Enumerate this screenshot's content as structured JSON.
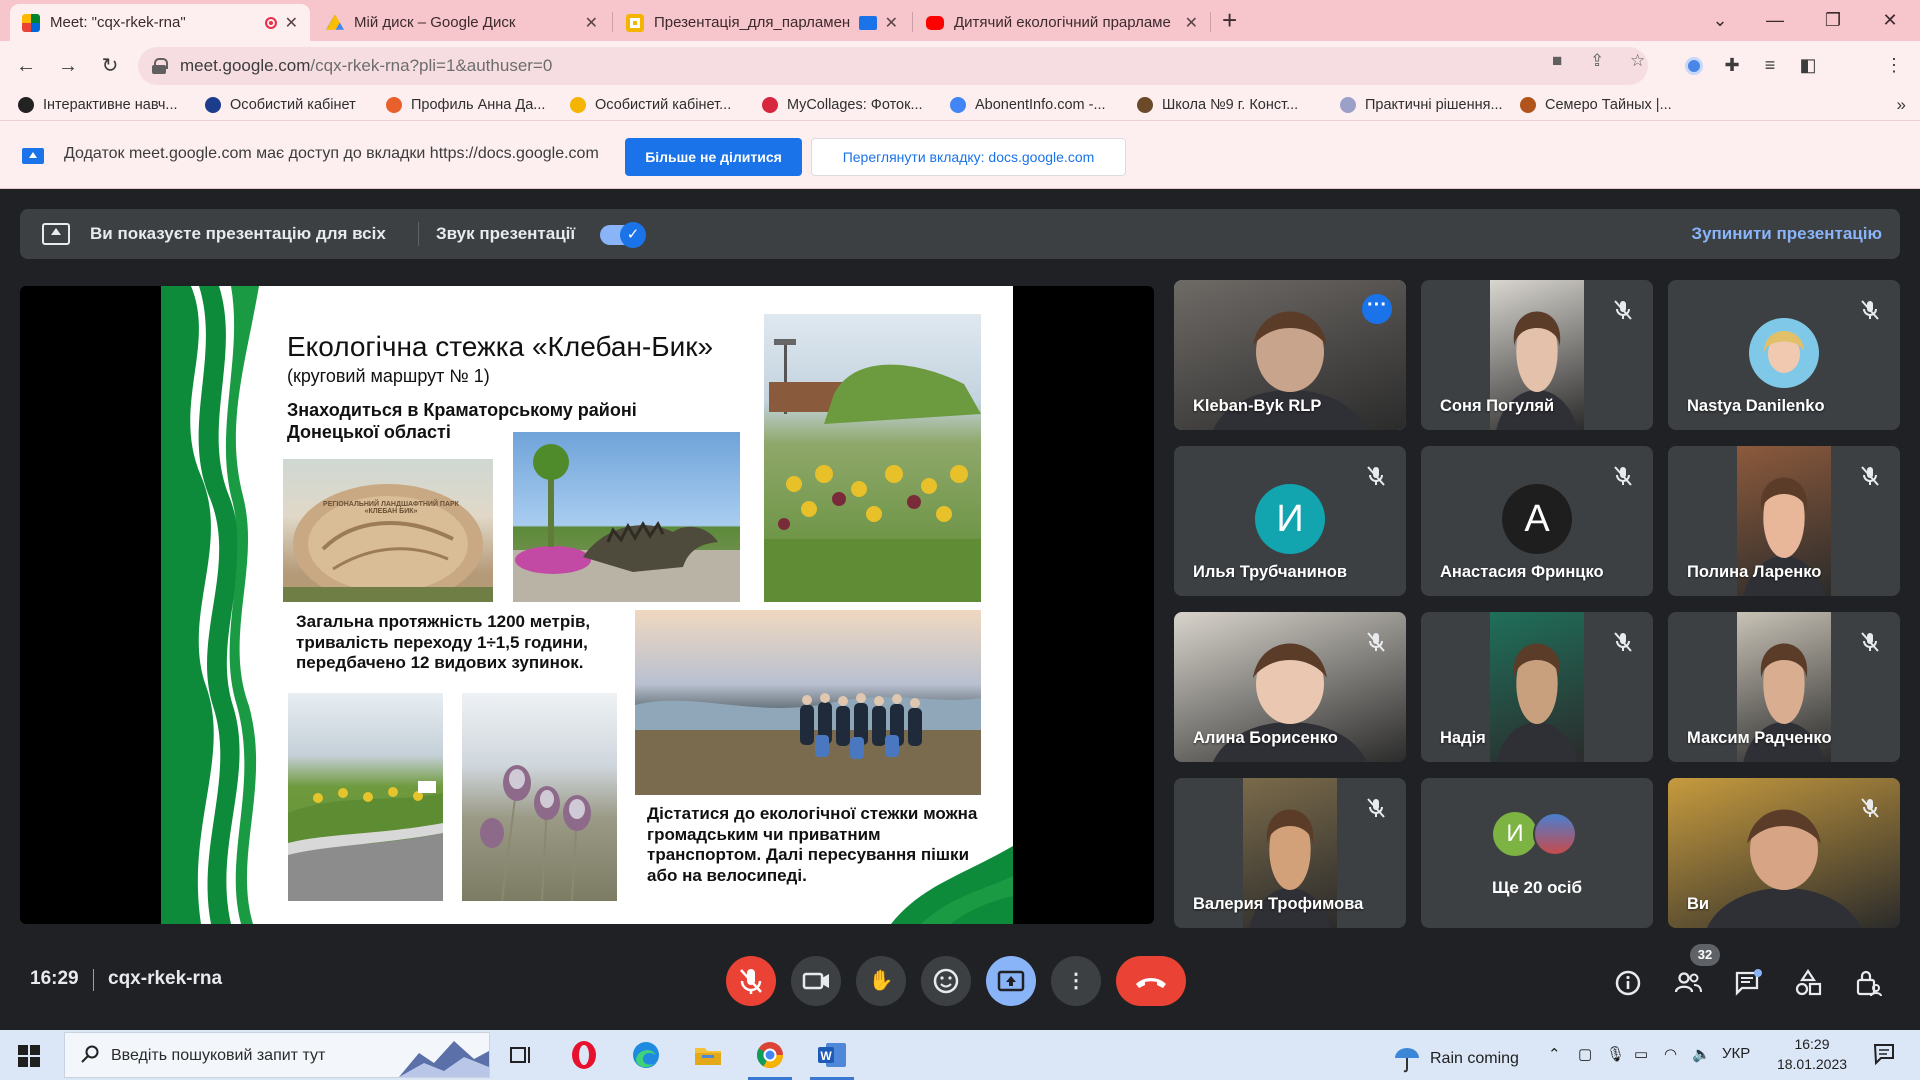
{
  "browser": {
    "tabs": [
      {
        "title": "Meet: \"cqx-rkek-rna\"",
        "favicon_color": "#00897b",
        "active": true
      },
      {
        "title": "Мій диск – Google Диск",
        "favicon_color": "#fbbc04",
        "active": false
      },
      {
        "title": "Презентація_для_парламен",
        "favicon_color": "#f4b400",
        "active": false
      },
      {
        "title": "Дитячий екологічний прарламе",
        "favicon_color": "#ff0000",
        "active": false
      }
    ],
    "url_host": "meet.google.com",
    "url_path": "/cqx-rkek-rna?pli=1&authuser=0",
    "bookmarks": [
      {
        "label": "Інтерактивне навч...",
        "color": "#222222"
      },
      {
        "label": "Особистий кабінет",
        "color": "#1c3c8c"
      },
      {
        "label": "Профиль Анна Да...",
        "color": "#e8612c"
      },
      {
        "label": "Особистий кабінет...",
        "color": "#f5b400"
      },
      {
        "label": "MyCollages: Фоток...",
        "color": "#d7263d"
      },
      {
        "label": "AbonentInfo.com -...",
        "color": "#4285f4"
      },
      {
        "label": "Школа №9 г. Конст...",
        "color": "#6b4a2a"
      },
      {
        "label": "Практичні рішення...",
        "color": "#9aa0c8"
      },
      {
        "label": "Семеро Тайных |...",
        "color": "#b0541b"
      }
    ]
  },
  "share_bar": {
    "message": "Додаток meet.google.com має доступ до вкладки https://docs.google.com",
    "stop_sharing_label": "Більше не ділитися",
    "view_tab_label": "Переглянути вкладку: docs.google.com"
  },
  "presenting_bar": {
    "status": "Ви показуєте презентацію для всіх",
    "sound_label": "Звук презентації",
    "sound_on": true,
    "stop_label": "Зупинити презентацію"
  },
  "slide": {
    "title": "Екологічна стежка «Клебан-Бик»",
    "subtitle": "(круговий маршрут № 1)",
    "location": "Знаходиться в Краматорському районі Донецької області",
    "length_info": "Загальна протяжність 1200 метрів, тривалість переходу 1÷1,5 години, передбачено 12 видових зупинок.",
    "transport_info": "Дістатися до екологічної стежки можна громадським чи приватним транспортом. Далі пересування пішки або на велосипеді.",
    "stone_text": "РЕГІОНАЛЬНИЙ ЛАНДШАФТНИЙ ПАРК «КЛЕБАН БИК»"
  },
  "participants": [
    {
      "name": "Kleban-Byk RLP",
      "type": "video",
      "muted": false,
      "speaking": true,
      "skin": "#c9a48c",
      "bg": "#6e6a66"
    },
    {
      "name": "Соня Погуляй",
      "type": "video",
      "muted": true,
      "skin": "#e3c1aa",
      "bg": "#d9d6d0"
    },
    {
      "name": "Nastya Danilenko",
      "type": "photo",
      "muted": true,
      "skin": "#f1c9b0",
      "bg": "#7fc8e8"
    },
    {
      "name": "Илья Трубчанинов",
      "type": "avatar",
      "initial": "И",
      "avatar_color": "#12a4af",
      "muted": true
    },
    {
      "name": "Анастасия Фринцко",
      "type": "avatar",
      "initial": "А",
      "avatar_color": "#1e1e1e",
      "muted": true
    },
    {
      "name": "Полина Ларенко",
      "type": "video",
      "muted": true,
      "skin": "#e8b79a",
      "bg": "#8c5a3c"
    },
    {
      "name": "Алина Борисенко",
      "type": "video",
      "muted": true,
      "skin": "#e9c7b1",
      "bg": "#d8d4cc"
    },
    {
      "name": "Надія",
      "type": "video",
      "muted": true,
      "skin": "#c9a07d",
      "bg": "#1f6f5a"
    },
    {
      "name": "Максим Радченко",
      "type": "video",
      "muted": true,
      "skin": "#d9ad90",
      "bg": "#c8c2b6"
    },
    {
      "name": "Валерия Трофимова",
      "type": "video",
      "muted": true,
      "skin": "#d2a17a",
      "bg": "#7a6a4a"
    },
    {
      "name": "Ще 20 осіб",
      "type": "others",
      "initial": "И",
      "avatar_color": "#7cb342"
    },
    {
      "name": "Ви",
      "type": "video",
      "muted": true,
      "skin": "#d7a585",
      "bg": "#c79b3e"
    }
  ],
  "meeting": {
    "time": "16:29",
    "code": "cqx-rkek-rna",
    "people_count": "32"
  },
  "taskbar": {
    "search_placeholder": "Введіть пошуковий запит тут",
    "weather": "Rain coming",
    "language": "УКР",
    "time": "16:29",
    "date": "18.01.2023"
  }
}
